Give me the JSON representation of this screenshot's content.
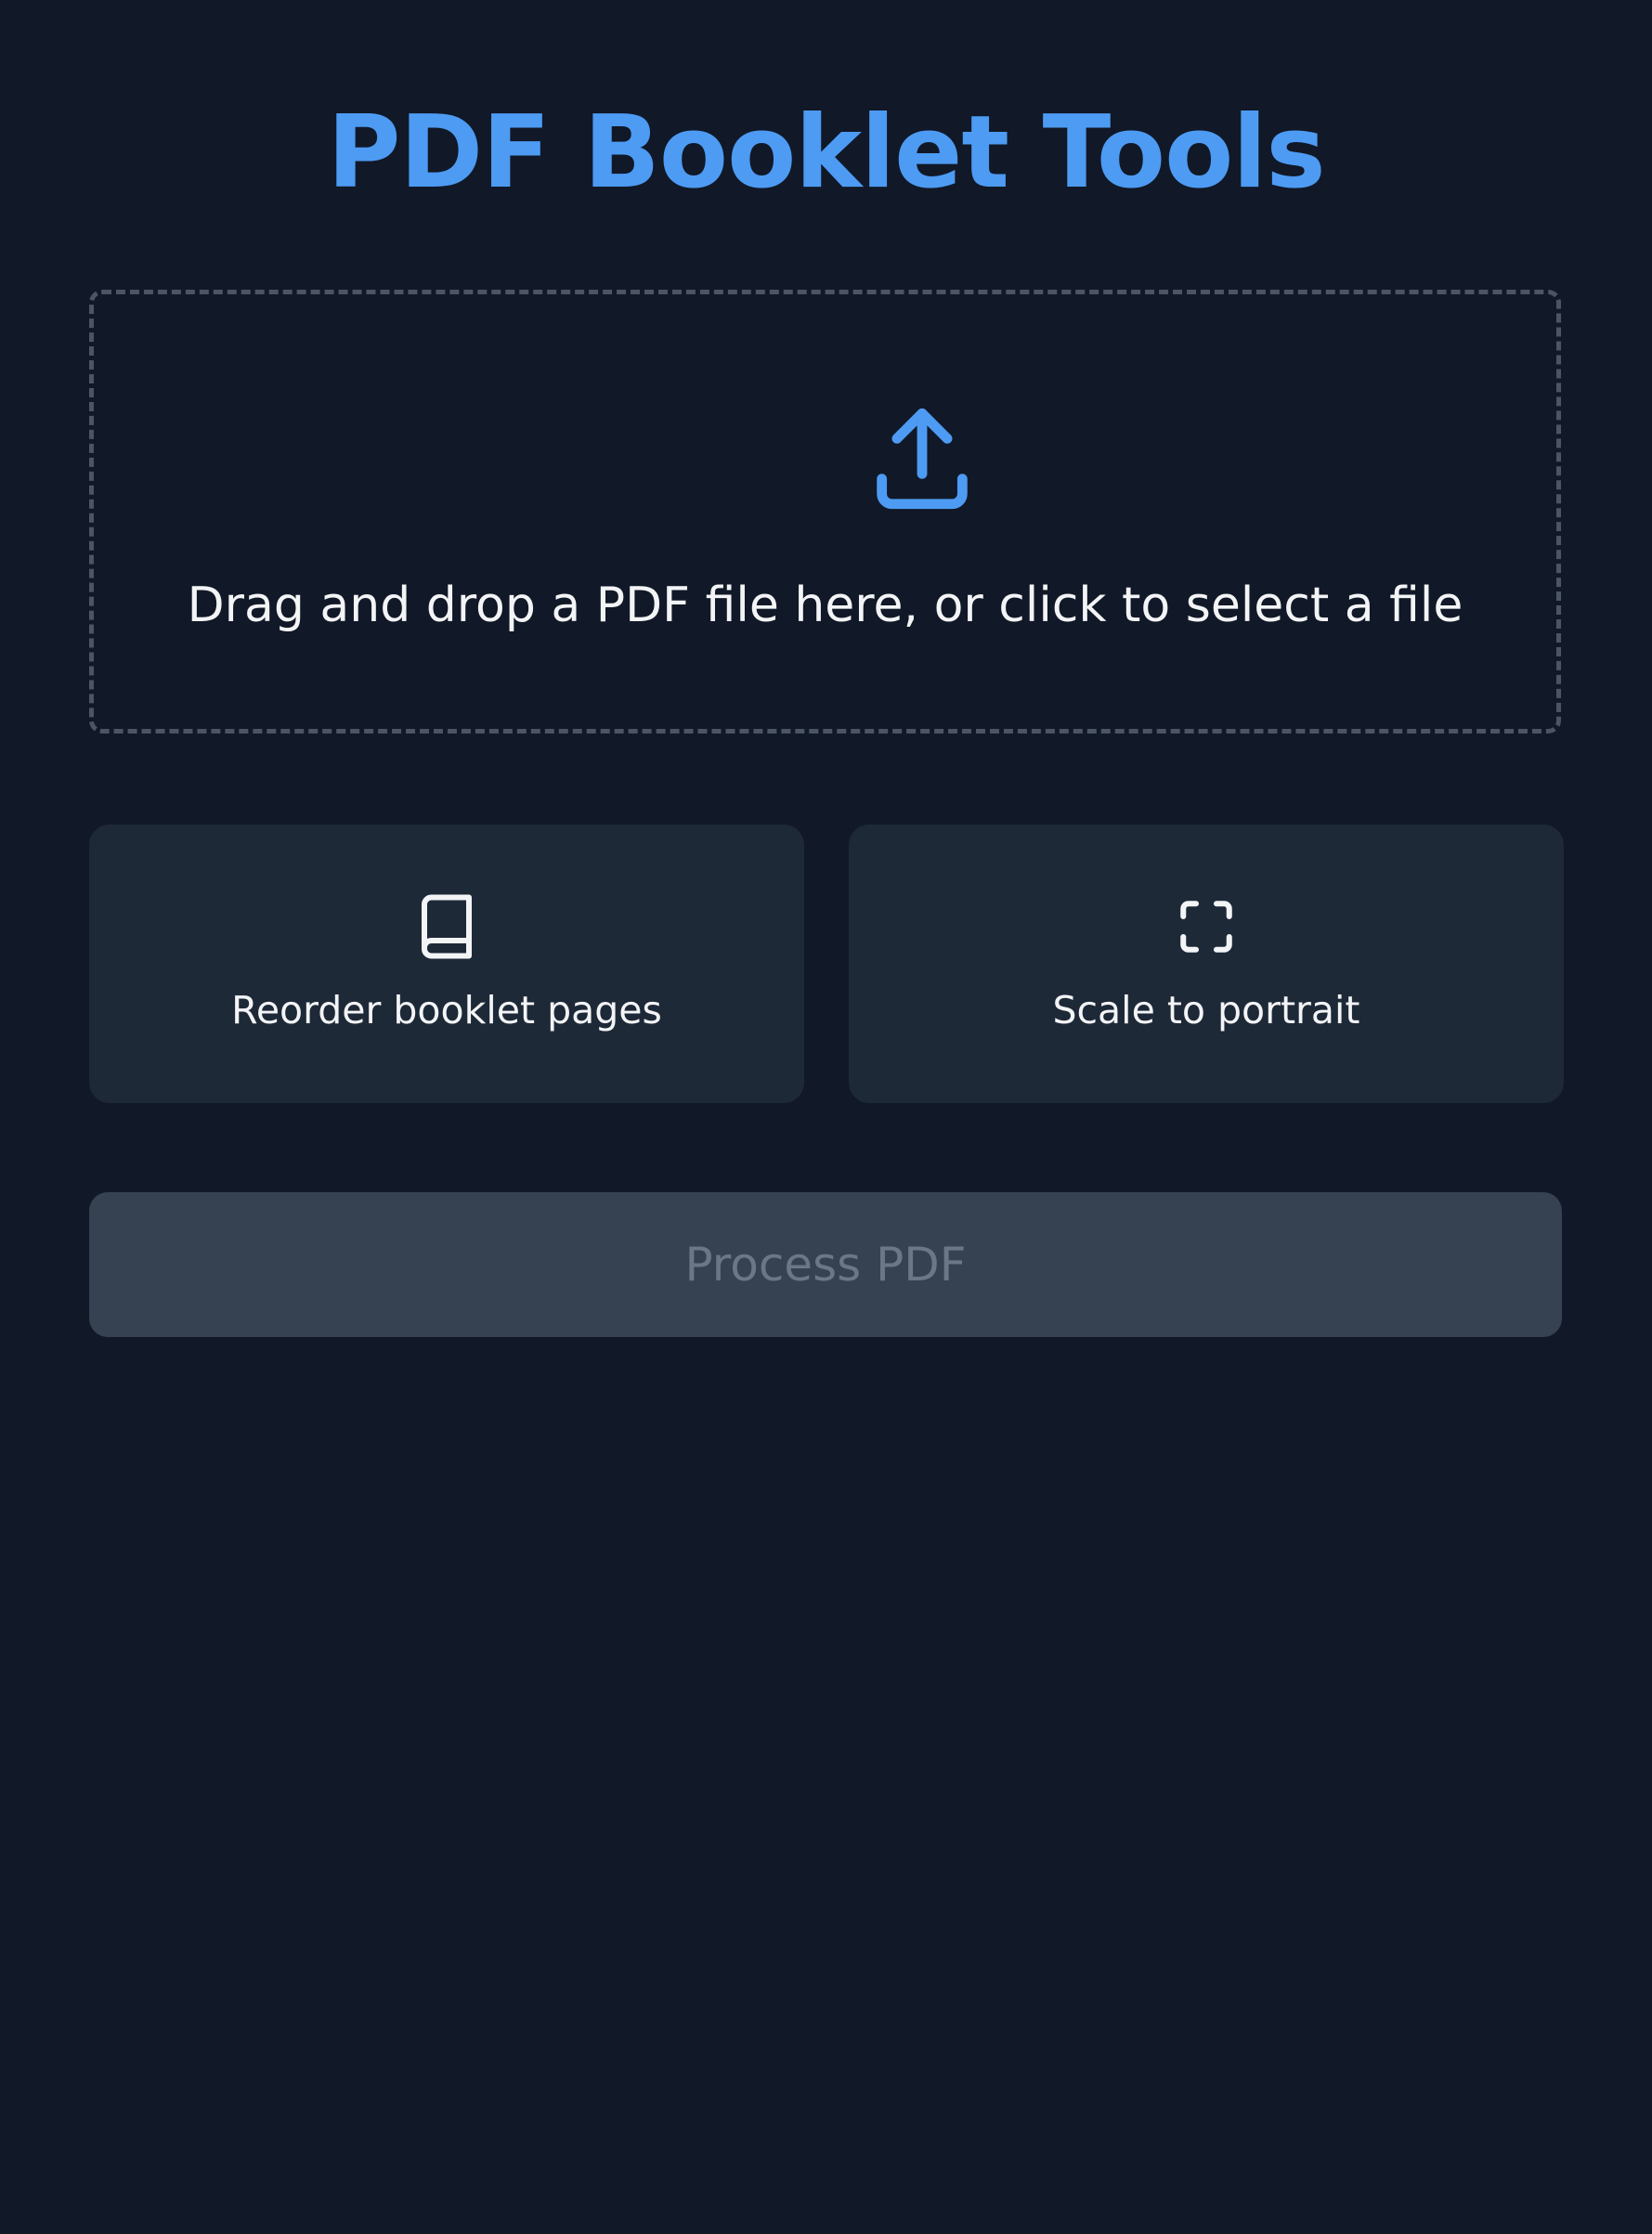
{
  "header": {
    "title": "PDF Booklet Tools"
  },
  "dropzone": {
    "icon": "upload-icon",
    "text": "Drag and drop a PDF file here, or click to select a file"
  },
  "options": [
    {
      "icon": "book-icon",
      "label": "Reorder booklet pages"
    },
    {
      "icon": "fullscreen-icon",
      "label": "Scale to portrait"
    }
  ],
  "actions": {
    "process_label": "Process PDF",
    "process_enabled": false
  },
  "colors": {
    "background": "#111827",
    "accent": "#4d9bf3",
    "card": "#1e2938",
    "button_disabled": "#364152",
    "button_text_disabled": "#6b7687",
    "dashed_border": "#4b5563",
    "text": "#f3f4f6"
  }
}
